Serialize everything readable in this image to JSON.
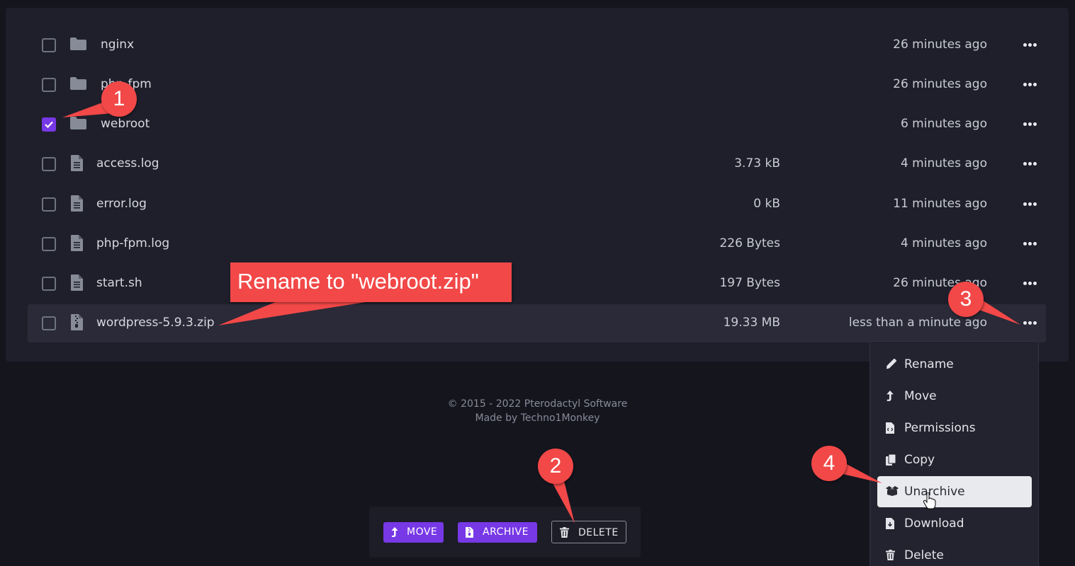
{
  "files": [
    {
      "name": "nginx",
      "type": "folder",
      "size": "",
      "modified": "26 minutes ago",
      "checked": false
    },
    {
      "name": "php-fpm",
      "type": "folder",
      "size": "",
      "modified": "26 minutes ago",
      "checked": false
    },
    {
      "name": "webroot",
      "type": "folder",
      "size": "",
      "modified": "6 minutes ago",
      "checked": true
    },
    {
      "name": "access.log",
      "type": "file",
      "size": "3.73 kB",
      "modified": "4 minutes ago",
      "checked": false
    },
    {
      "name": "error.log",
      "type": "file",
      "size": "0 kB",
      "modified": "11 minutes ago",
      "checked": false
    },
    {
      "name": "php-fpm.log",
      "type": "file",
      "size": "226 Bytes",
      "modified": "4 minutes ago",
      "checked": false
    },
    {
      "name": "start.sh",
      "type": "file",
      "size": "197 Bytes",
      "modified": "26 minutes ago",
      "checked": false
    },
    {
      "name": "wordpress-5.9.3.zip",
      "type": "archive",
      "size": "19.33 MB",
      "modified": "less than a minute ago",
      "checked": false
    }
  ],
  "footer": {
    "copyright": "© 2015 - 2022 Pterodactyl Software",
    "credit": "Made by Techno1Monkey"
  },
  "action_bar": {
    "move": "MOVE",
    "archive": "ARCHIVE",
    "delete": "DELETE"
  },
  "context_menu": {
    "items": [
      {
        "label": "Rename",
        "icon": "pencil-icon"
      },
      {
        "label": "Move",
        "icon": "move-arrow-icon"
      },
      {
        "label": "Permissions",
        "icon": "file-code-icon"
      },
      {
        "label": "Copy",
        "icon": "copy-icon"
      },
      {
        "label": "Unarchive",
        "icon": "box-open-icon",
        "active": true
      },
      {
        "label": "Download",
        "icon": "file-download-icon"
      },
      {
        "label": "Delete",
        "icon": "trash-icon"
      }
    ]
  },
  "annotations": {
    "step1": "1",
    "step2": "2",
    "step3": "3",
    "step4": "4",
    "rename_note": "Rename to \"webroot.zip\""
  },
  "colors": {
    "accent": "#7738e6",
    "annotation": "#f24848",
    "background": "#15151e",
    "panel": "#1f1f2b"
  }
}
